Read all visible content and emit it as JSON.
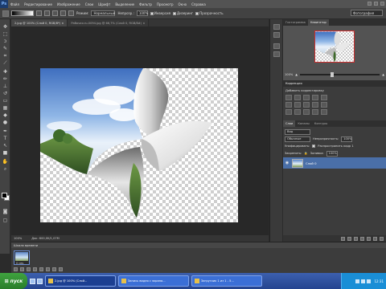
{
  "app": {
    "logo": "Ps"
  },
  "menu": [
    "Файл",
    "Редактирование",
    "Изображение",
    "Слои",
    "Шрифт",
    "Выделение",
    "Фильтр",
    "Просмотр",
    "Окно",
    "Справка"
  ],
  "options": {
    "mode_label": "Режим:",
    "mode_value": "Нормальный",
    "opacity_label": "Непрозр.:",
    "opacity_value": "100%",
    "inversion": "Инверсия",
    "dither": "Дизеринг",
    "transparency": "Прозрачность",
    "workspace": "Фотография"
  },
  "document": {
    "tab_active": "2.jpg @ 100% (Слой 0, RGB/8*) ×",
    "tab_inactive": "Рабочая.ru-0094.jpg @ 66,7% (Слой 0, RGB/8#) ×"
  },
  "status": {
    "zoom": "100%",
    "doc_size": "Док: 600,0K/1,07M"
  },
  "timeline": {
    "title": "Шкала времени",
    "frame_time": "0 сек."
  },
  "navigator": {
    "tab_histogram": "Гистограмма",
    "tab_navigator": "Навигатор",
    "zoom_value": "100%"
  },
  "adjustments": {
    "header": "Коррекция",
    "title": "Добавить корректировку"
  },
  "layers": {
    "tabs": [
      "Слои",
      "Каналы",
      "Контуры"
    ],
    "kind": "Вид",
    "blend": "Обычные",
    "opacity_label": "Непрозрачность:",
    "opacity_value": "100%",
    "unify_label": "Унифицировать:",
    "propagate": "Распространить кадр 1",
    "lock_label": "Закрепить:",
    "fill_label": "Заливка:",
    "fill_value": "100%",
    "layer_name": "Слой 0"
  },
  "taskbar": {
    "start": "пуск",
    "buttons": [
      "2.jpg @ 100% (Слой...",
      "Запись видео с экрана...",
      "Загрузчик 1 из 1 - 5..."
    ],
    "clock": "12:31"
  }
}
